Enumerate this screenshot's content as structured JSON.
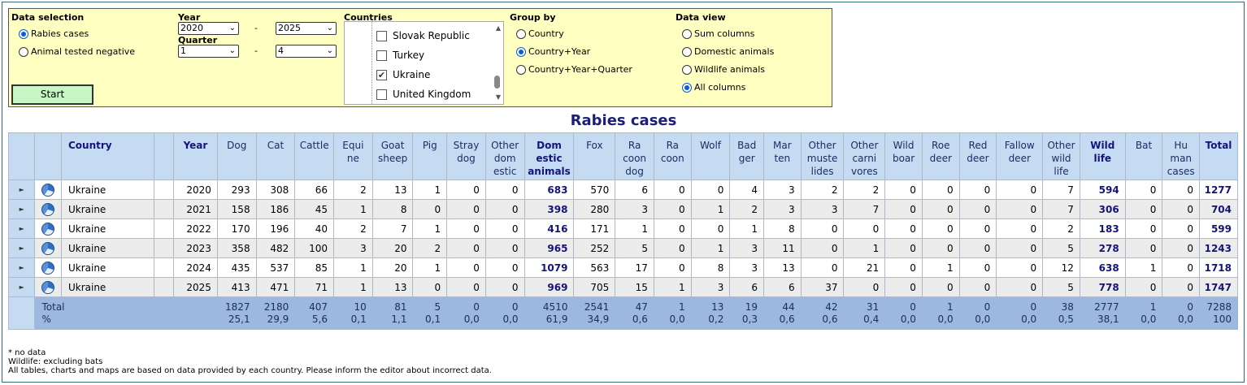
{
  "selection": {
    "data_selection_title": "Data selection",
    "data_options": [
      {
        "label": "Rabies cases",
        "selected": true
      },
      {
        "label": "Animal tested negative",
        "selected": false
      }
    ],
    "year_title": "Year",
    "year_from": "2020",
    "year_to": "2025",
    "quarter_title": "Quarter",
    "quarter_from": "1",
    "quarter_to": "4",
    "range_separator": "-",
    "start_label": "Start",
    "countries_title": "Countries",
    "countries": [
      {
        "label": "Slovak Republic",
        "checked": false
      },
      {
        "label": "Turkey",
        "checked": false
      },
      {
        "label": "Ukraine",
        "checked": true
      },
      {
        "label": "United Kingdom",
        "checked": false
      }
    ],
    "group_by_title": "Group by",
    "group_by": [
      {
        "label": "Country",
        "selected": false
      },
      {
        "label": "Country+Year",
        "selected": true
      },
      {
        "label": "Country+Year+Quarter",
        "selected": false
      }
    ],
    "data_view_title": "Data view",
    "data_view": [
      {
        "label": "Sum columns",
        "selected": false
      },
      {
        "label": "Domestic animals",
        "selected": false
      },
      {
        "label": "Wildlife animals",
        "selected": false
      },
      {
        "label": "All columns",
        "selected": true
      }
    ]
  },
  "title": "Rabies cases",
  "table": {
    "headers": {
      "country": "Country",
      "year": "Year",
      "dog": "Dog",
      "cat": "Cat",
      "cattle": "Cattle",
      "equine": "Equi ne",
      "goat_sheep": "Goat sheep",
      "pig": "Pig",
      "stray_dog": "Stray dog",
      "other_domestic": "Other dom estic",
      "domestic_animals": "Dom estic animals",
      "fox": "Fox",
      "raccoon_dog": "Ra coon dog",
      "raccoon": "Ra coon",
      "wolf": "Wolf",
      "badger": "Bad ger",
      "marten": "Mar ten",
      "other_mustelides": "Other muste lides",
      "other_carnivores": "Other carni vores",
      "wild_boar": "Wild boar",
      "roe_deer": "Roe deer",
      "red_deer": "Red deer",
      "fallow_deer": "Fallow deer",
      "other_wildlife": "Other wild life",
      "wildlife": "Wild life",
      "bat": "Bat",
      "human_cases": "Hu man cases",
      "total": "Total"
    },
    "rows": [
      {
        "country": "Ukraine",
        "year": "2020",
        "values": [
          "293",
          "308",
          "66",
          "2",
          "13",
          "1",
          "0",
          "0",
          "683",
          "570",
          "6",
          "0",
          "0",
          "4",
          "3",
          "2",
          "2",
          "0",
          "0",
          "0",
          "0",
          "7",
          "594",
          "0",
          "0",
          "1277"
        ]
      },
      {
        "country": "Ukraine",
        "year": "2021",
        "values": [
          "158",
          "186",
          "45",
          "1",
          "8",
          "0",
          "0",
          "0",
          "398",
          "280",
          "3",
          "0",
          "1",
          "2",
          "3",
          "3",
          "7",
          "0",
          "0",
          "0",
          "0",
          "7",
          "306",
          "0",
          "0",
          "704"
        ]
      },
      {
        "country": "Ukraine",
        "year": "2022",
        "values": [
          "170",
          "196",
          "40",
          "2",
          "7",
          "1",
          "0",
          "0",
          "416",
          "171",
          "1",
          "0",
          "0",
          "1",
          "8",
          "0",
          "0",
          "0",
          "0",
          "0",
          "0",
          "2",
          "183",
          "0",
          "0",
          "599"
        ]
      },
      {
        "country": "Ukraine",
        "year": "2023",
        "values": [
          "358",
          "482",
          "100",
          "3",
          "20",
          "2",
          "0",
          "0",
          "965",
          "252",
          "5",
          "0",
          "1",
          "3",
          "11",
          "0",
          "1",
          "0",
          "0",
          "0",
          "0",
          "5",
          "278",
          "0",
          "0",
          "1243"
        ]
      },
      {
        "country": "Ukraine",
        "year": "2024",
        "values": [
          "435",
          "537",
          "85",
          "1",
          "20",
          "1",
          "0",
          "0",
          "1079",
          "563",
          "17",
          "0",
          "8",
          "3",
          "13",
          "0",
          "21",
          "0",
          "1",
          "0",
          "0",
          "12",
          "638",
          "1",
          "0",
          "1718"
        ]
      },
      {
        "country": "Ukraine",
        "year": "2025",
        "values": [
          "413",
          "471",
          "71",
          "1",
          "13",
          "0",
          "0",
          "0",
          "969",
          "705",
          "15",
          "1",
          "3",
          "6",
          "6",
          "37",
          "0",
          "0",
          "0",
          "0",
          "0",
          "5",
          "778",
          "0",
          "0",
          "1747"
        ]
      }
    ],
    "total_label": "Total",
    "percent_label": "%",
    "totals": [
      "1827",
      "2180",
      "407",
      "10",
      "81",
      "5",
      "0",
      "0",
      "4510",
      "2541",
      "47",
      "1",
      "13",
      "19",
      "44",
      "42",
      "31",
      "0",
      "1",
      "0",
      "0",
      "38",
      "2777",
      "1",
      "0",
      "7288"
    ],
    "percents": [
      "25,1",
      "29,9",
      "5,6",
      "0,1",
      "1,1",
      "0,1",
      "0,0",
      "0,0",
      "61,9",
      "34,9",
      "0,6",
      "0,0",
      "0,2",
      "0,3",
      "0,6",
      "0,6",
      "0,4",
      "0,0",
      "0,0",
      "0,0",
      "0,0",
      "0,5",
      "38,1",
      "0,0",
      "0,0",
      "100"
    ]
  },
  "notes": [
    "* no data",
    "Wildlife: excluding bats",
    "All tables, charts and maps are based on data provided by each country. Please inform the editor about incorrect data."
  ]
}
